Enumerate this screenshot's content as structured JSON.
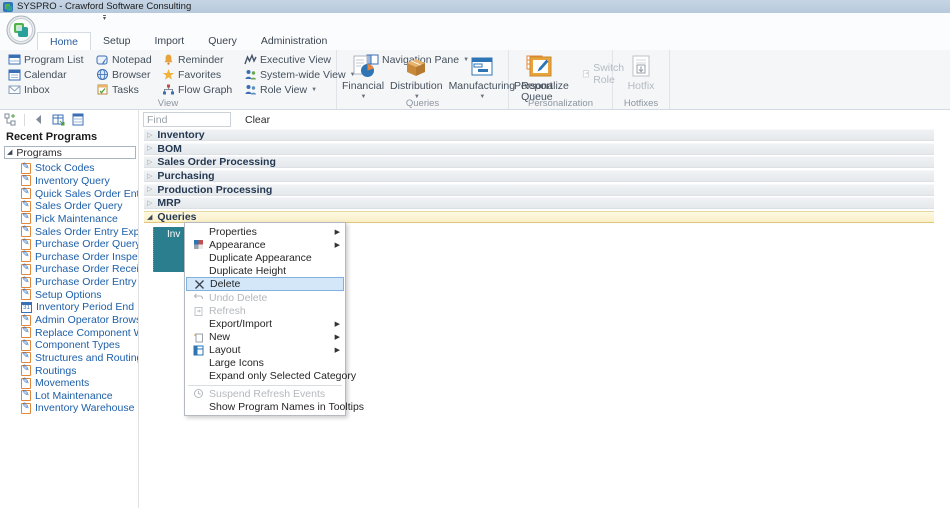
{
  "window": {
    "title": "SYSPRO - Crawford Software Consulting"
  },
  "ribbon": {
    "tabs": [
      {
        "label": "Home",
        "active": true
      },
      {
        "label": "Setup",
        "active": false
      },
      {
        "label": "Import",
        "active": false
      },
      {
        "label": "Query",
        "active": false
      },
      {
        "label": "Administration",
        "active": false
      }
    ],
    "view_group": {
      "label": "View",
      "buttons": [
        {
          "label": "Program List",
          "icon": "program-list-icon"
        },
        {
          "label": "Notepad",
          "icon": "notepad-icon"
        },
        {
          "label": "Reminder",
          "icon": "bell-icon"
        },
        {
          "label": "Executive View",
          "icon": "chart-icon"
        },
        {
          "label": "Navigation Pane",
          "icon": "navigation-pane-icon",
          "dropdown": true
        },
        {
          "label": "Calendar",
          "icon": "calendar-icon"
        },
        {
          "label": "Browser",
          "icon": "globe-icon"
        },
        {
          "label": "Favorites",
          "icon": "star-icon"
        },
        {
          "label": "System-wide View",
          "icon": "people-icon",
          "dropdown": true
        },
        {
          "label": "Inbox",
          "icon": "envelope-icon"
        },
        {
          "label": "Tasks",
          "icon": "tasks-icon"
        },
        {
          "label": "Flow Graph",
          "icon": "flow-graph-icon"
        },
        {
          "label": "Role View",
          "icon": "people-icon",
          "dropdown": true
        }
      ]
    },
    "queries_group": {
      "label": "Queries",
      "buttons": [
        {
          "label": "Financial",
          "icon": "financial-icon",
          "dropdown": true
        },
        {
          "label": "Distribution",
          "icon": "distribution-icon",
          "dropdown": true
        },
        {
          "label": "Manufacturing",
          "icon": "manufacturing-icon",
          "dropdown": true
        },
        {
          "label": "Report Queue",
          "icon": "report-queue-icon",
          "dropdown": false
        }
      ]
    },
    "personalization_group": {
      "label": "Personalization",
      "personalize_label": "Personalize",
      "switch_role_label": "Switch Role"
    },
    "hotfixes_group": {
      "label": "Hotfixes",
      "hotfix_label": "Hotfix"
    }
  },
  "sidebar": {
    "header": "Recent Programs",
    "root": "Programs",
    "items": [
      "Stock Codes",
      "Inventory Query",
      "Quick Sales Order Entry",
      "Sales Order Query",
      "Pick Maintenance",
      "Sales Order Entry Express",
      "Purchase Order Query",
      "Purchase Order Inspection",
      "Purchase Order Receipts",
      "Purchase Order Entry",
      "Setup Options",
      "Inventory Period End",
      "Admin Operator Browse",
      "Replace Component Wher...",
      "Component Types",
      "Structures and Routings",
      "Routings",
      "Movements",
      "Lot Maintenance",
      "Inventory Warehouse Main..."
    ]
  },
  "main": {
    "find_placeholder": "Find",
    "clear_label": "Clear",
    "categories": [
      {
        "label": "Inventory",
        "expanded": false
      },
      {
        "label": "BOM",
        "expanded": false
      },
      {
        "label": "Sales Order Processing",
        "expanded": false
      },
      {
        "label": "Purchasing",
        "expanded": false
      },
      {
        "label": "Production Processing",
        "expanded": false
      },
      {
        "label": "MRP",
        "expanded": false
      },
      {
        "label": "Queries",
        "expanded": true
      }
    ],
    "tile": {
      "label": "Inv",
      "color": "#2a7e8e"
    }
  },
  "context_menu": {
    "items": [
      {
        "label": "Properties",
        "submenu": true
      },
      {
        "label": "Appearance",
        "submenu": true
      },
      {
        "label": "Duplicate Appearance"
      },
      {
        "label": "Duplicate Height"
      },
      {
        "label": "Delete",
        "highlighted": true
      },
      {
        "label": "Undo Delete",
        "disabled": true
      },
      {
        "label": "Refresh",
        "disabled": true
      },
      {
        "label": "Export/Import",
        "submenu": true
      },
      {
        "label": "New",
        "submenu": true
      },
      {
        "label": "Layout",
        "submenu": true
      },
      {
        "label": "Large Icons"
      },
      {
        "label": "Expand only Selected Category"
      },
      {
        "label": "Suspend Refresh Events",
        "disabled": true
      },
      {
        "label": "Show Program Names in Tooltips"
      }
    ]
  },
  "colors": {
    "titlebar": "#bfd0e1",
    "selected_category_bg": "#fbf4d4",
    "selected_category_border": "#ddc87e",
    "menu_highlight_bg": "#d3e7f9",
    "menu_highlight_border": "#7fb2de",
    "tile": "#2a7e8e",
    "sidebar_link": "#1d5fa9",
    "active_tab_text": "#2a5d9e"
  }
}
